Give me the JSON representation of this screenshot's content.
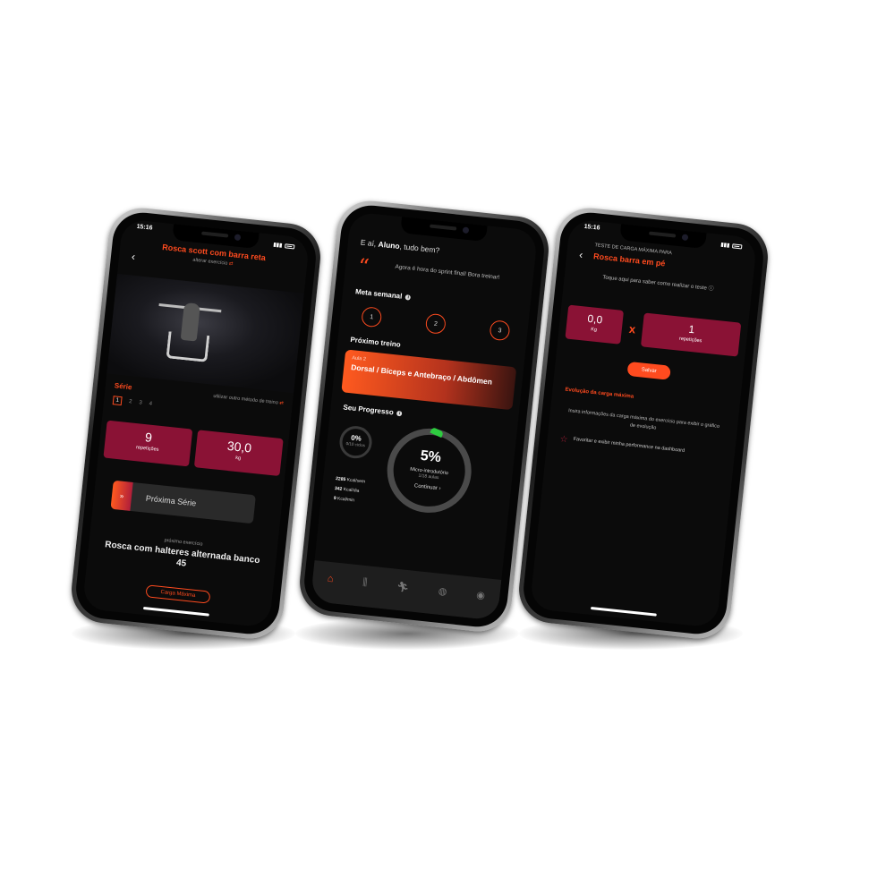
{
  "colors": {
    "accent": "#ff4b1f",
    "crimson": "#8a1235",
    "background": "#0b0b0b",
    "success": "#2ecc40"
  },
  "phone1": {
    "time": "15:16",
    "title": "Rosca scott com barra reta",
    "subtitle": "alterar exercício",
    "serie_label": "Série",
    "other_method": "utilizar outro método de treino",
    "sets": [
      "1",
      "2",
      "3",
      "4"
    ],
    "reps_value": "9",
    "reps_label": "repetições",
    "weight_value": "30,0",
    "weight_unit": "kg",
    "next_button": "Próxima Série",
    "next_exercise_label": "próximo exercício",
    "next_exercise_name": "Rosca com halteres alternada banco 45",
    "max_load_button": "Carga Máxima"
  },
  "phone2": {
    "greeting_prefix": "E aí,",
    "user_name": "Aluno",
    "greeting_suffix": ", tudo bem?",
    "quote": "Agora é hora do sprint final! Bora treinar!",
    "weekly_goal_title": "Meta semanal",
    "weekly_goals": [
      "1",
      "2",
      "3"
    ],
    "next_workout_title": "Próximo treino",
    "next_workout_lesson": "Aula 2",
    "next_workout_name": "Dorsal / Bíceps e Antebraço / Abdômen",
    "progress_title": "Seu Progresso",
    "cycles_percent": "0%",
    "cycles_label": "0/10 ciclos",
    "program_percent": "5%",
    "program_progress_fraction": 0.05,
    "program_name": "Micro-introdutório",
    "program_lessons": "1/18 aulas",
    "continue_label": "Continuar",
    "kcal": [
      {
        "value": "2285",
        "unit": "Kcal/sem"
      },
      {
        "value": "342",
        "unit": "Kcal/dia"
      },
      {
        "value": "9",
        "unit": "Kcal/min"
      }
    ],
    "tabs": [
      "home-icon",
      "dumbbell-icon",
      "running-icon",
      "gamepad-icon",
      "profile-icon"
    ]
  },
  "phone3": {
    "time": "15:16",
    "eyebrow": "TESTE DE CARGA MÁXIMA PARA",
    "title": "Rosca barra em pé",
    "touch_hint": "Toque aqui para saber como realizar o teste",
    "weight_value": "0,0",
    "weight_unit": "Kg",
    "times": "x",
    "reps_value": "1",
    "reps_label": "repetições",
    "save_button": "Salvar",
    "evolution_title": "Evolução da carga máxima",
    "evolution_hint": "Insira informações da carga máxima do exercício para exibir o gráfico de evolução",
    "favorite_text": "Favoritar e exibir minha performance na dashboard"
  }
}
